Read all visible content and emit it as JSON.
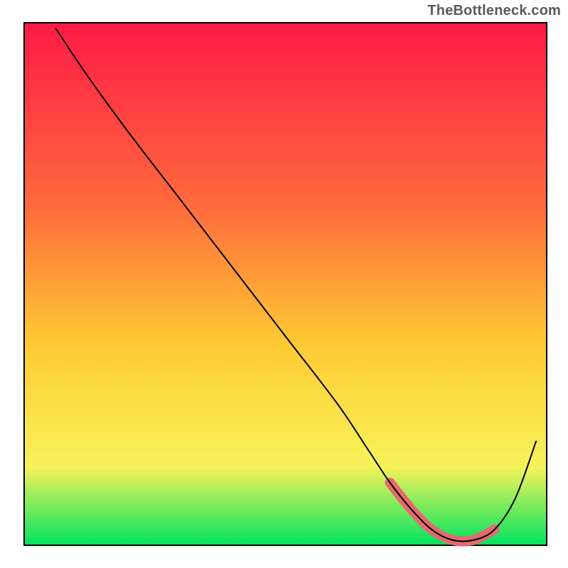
{
  "watermark": "TheBottleneck.com",
  "chart_data": {
    "type": "line",
    "title": "",
    "xlabel": "",
    "ylabel": "",
    "xlim": [
      0,
      100
    ],
    "ylim": [
      0,
      100
    ],
    "gradient": {
      "top": "#ff1a47",
      "upper_mid": "#ff6a3c",
      "mid": "#ffcc33",
      "lower_mid": "#f7f25a",
      "bottom": "#00e35f"
    },
    "series": [
      {
        "name": "bottleneck-curve",
        "note": "Black curve: y is relative bottleneck (0 at plot bottom, 100 at top). x is relative horizontal position (0 left, 100 right).",
        "x": [
          6,
          12,
          20,
          30,
          40,
          50,
          60,
          66,
          70,
          74,
          78,
          82,
          86,
          90,
          94,
          98
        ],
        "y": [
          99,
          90,
          79,
          66,
          53,
          40,
          27,
          18,
          12,
          7,
          3,
          1,
          1,
          3,
          9,
          20
        ]
      },
      {
        "name": "optimal-range-highlight",
        "note": "Pink rounded segment sitting on the valley floor of the curve (approximate optimal zone).",
        "color": "#e46a6f",
        "x": [
          70,
          74,
          78,
          82,
          86,
          90
        ],
        "y": [
          12,
          7,
          3,
          1,
          1,
          3
        ]
      }
    ]
  }
}
